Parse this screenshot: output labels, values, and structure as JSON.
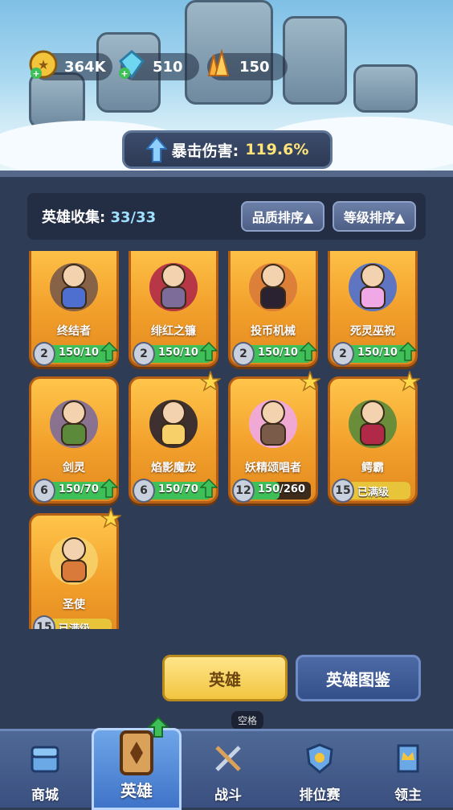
{
  "resources": {
    "gold": "364K",
    "gems": "510",
    "crystals": "150"
  },
  "crit": {
    "label": "暴击伤害:",
    "value": "119.6%"
  },
  "collection": {
    "label": "英雄收集: ",
    "count": "33/33",
    "sort_quality": "品质排序▲",
    "sort_level": "等级排序▲"
  },
  "heroes": [
    {
      "name": "终结者",
      "level": "2",
      "progress": "150/10",
      "ratio": 1.0,
      "state": "upgrade"
    },
    {
      "name": "绯红之镰",
      "level": "2",
      "progress": "150/10",
      "ratio": 1.0,
      "state": "upgrade"
    },
    {
      "name": "投币机械",
      "level": "2",
      "progress": "150/10",
      "ratio": 1.0,
      "state": "upgrade"
    },
    {
      "name": "死灵巫祝",
      "level": "2",
      "progress": "150/10",
      "ratio": 1.0,
      "state": "upgrade"
    },
    {
      "name": "剑灵",
      "level": "6",
      "progress": "150/70",
      "ratio": 1.0,
      "state": "upgrade"
    },
    {
      "name": "焰影魔龙",
      "level": "6",
      "progress": "150/70",
      "ratio": 1.0,
      "state": "upgrade"
    },
    {
      "name": "妖精颂唱者",
      "level": "12",
      "progress": "150/260",
      "ratio": 0.58,
      "state": "progress"
    },
    {
      "name": "鳄霸",
      "level": "15",
      "progress": "已满级",
      "ratio": 1.0,
      "state": "max"
    },
    {
      "name": "圣使",
      "level": "15",
      "progress": "已满级",
      "ratio": 1.0,
      "state": "max"
    }
  ],
  "buttons": {
    "hero": "英雄",
    "atlas": "英雄图鉴"
  },
  "tooltip": "空格",
  "tabs": [
    "商城",
    "英雄",
    "战斗",
    "排位赛",
    "领主"
  ],
  "colors": {
    "background": "#2f3c55",
    "accent_gold": "#f2c540",
    "accent_green": "#3fbf58",
    "crit_value": "#ffe47a"
  }
}
